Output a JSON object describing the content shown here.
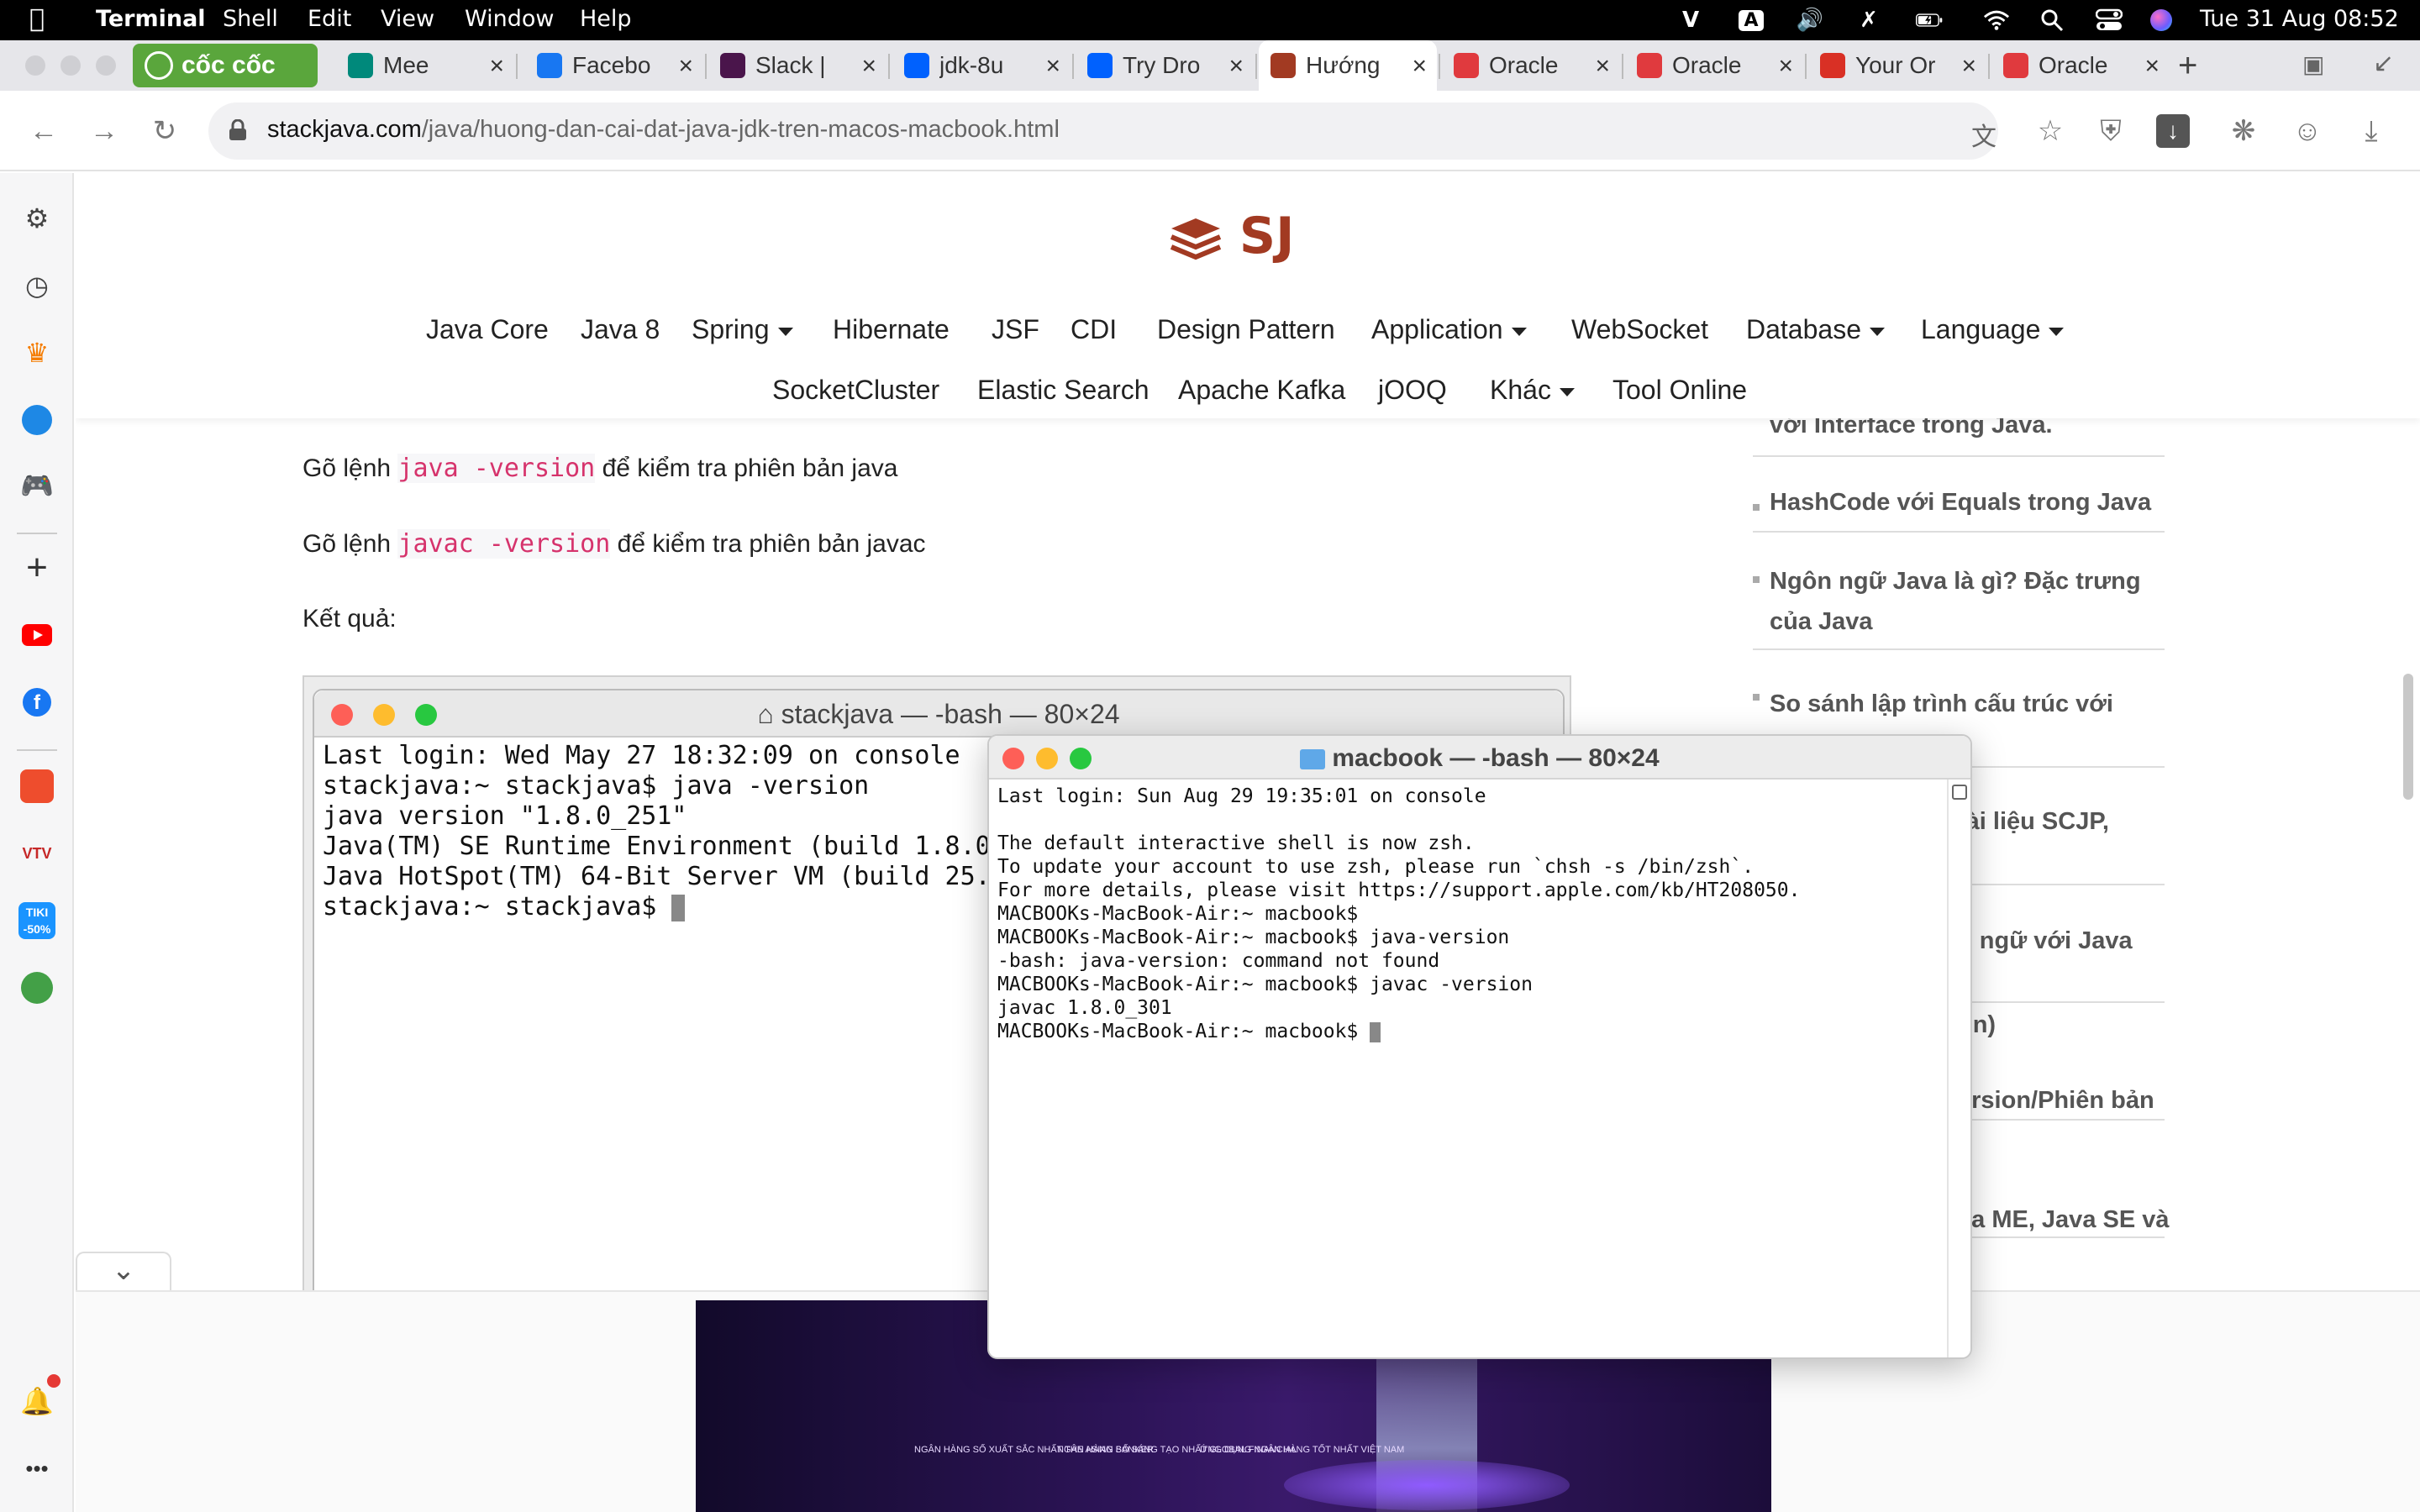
{
  "menubar": {
    "app": "Terminal",
    "items": [
      "Shell",
      "Edit",
      "View",
      "Window",
      "Help"
    ],
    "clock": "Tue 31 Aug  08:52",
    "input_source": "A"
  },
  "browser": {
    "brand_tab": "cốc cốc",
    "tabs": [
      {
        "label": "Mee",
        "icon": "google-meet-icon",
        "color": "#00897b"
      },
      {
        "label": "Facebo",
        "icon": "facebook-icon",
        "color": "#1877f2"
      },
      {
        "label": "Slack |",
        "icon": "slack-icon",
        "color": "#4a154b"
      },
      {
        "label": "jdk-8u",
        "icon": "dropbox-icon",
        "color": "#0061fe"
      },
      {
        "label": "Try Dro",
        "icon": "dropbox-icon",
        "color": "#0061fe"
      },
      {
        "label": "Hướng",
        "icon": "stackjava-icon",
        "color": "#a23a22"
      },
      {
        "label": "Oracle",
        "icon": "oracle-icon",
        "color": "#e03a3e"
      },
      {
        "label": "Oracle",
        "icon": "oracle-icon",
        "color": "#e03a3e"
      },
      {
        "label": "Your Or",
        "icon": "gmail-icon",
        "color": "#d93025"
      },
      {
        "label": "Oracle",
        "icon": "oracle-icon",
        "color": "#e03a3e"
      }
    ],
    "url_host": "stackjava.com",
    "url_path": "/java/huong-dan-cai-dat-java-jdk-tren-macos-macbook.html"
  },
  "site": {
    "logo": "SJ",
    "nav_row1": [
      {
        "label": "Java Core",
        "dropdown": false
      },
      {
        "label": "Java 8",
        "dropdown": false
      },
      {
        "label": "Spring",
        "dropdown": true
      },
      {
        "label": "Hibernate",
        "dropdown": false
      },
      {
        "label": "JSF",
        "dropdown": false
      },
      {
        "label": "CDI",
        "dropdown": false
      },
      {
        "label": "Design Pattern",
        "dropdown": false
      },
      {
        "label": "Application",
        "dropdown": true
      },
      {
        "label": "WebSocket",
        "dropdown": false
      },
      {
        "label": "Database",
        "dropdown": true
      },
      {
        "label": "Language",
        "dropdown": true
      }
    ],
    "nav_row2": [
      {
        "label": "SocketCluster",
        "dropdown": false
      },
      {
        "label": "Elastic Search",
        "dropdown": false
      },
      {
        "label": "Apache Kafka",
        "dropdown": false
      },
      {
        "label": "jOOQ",
        "dropdown": false
      },
      {
        "label": "Khác",
        "dropdown": true
      },
      {
        "label": "Tool Online",
        "dropdown": false
      }
    ],
    "article": {
      "line1_prefix": "Gõ lệnh",
      "line1_code": "java -version",
      "line1_suffix": "để kiểm tra phiên bản java",
      "line2_prefix": "Gõ lệnh",
      "line2_code": "javac -version",
      "line2_suffix": "để kiểm tra phiên bản javac",
      "result": "Kết quả:"
    },
    "sidebar_articles": [
      "với Interface trong Java.",
      "HashCode với Equals trong Java",
      "Ngôn ngữ Java là gì? Đặc trưng của Java",
      "So sánh lập trình cấu trúc với",
      "tài liệu SCJP,",
      "n ngữ với Java",
      "on)",
      "ersion/Phiên bản",
      "va ME, Java SE và"
    ]
  },
  "terminal_bg": {
    "title": "stackjava — -bash — 80×24",
    "lines": [
      "Last login: Wed May 27 18:32:09 on console",
      "stackjava:~ stackjava$ java -version",
      "java version \"1.8.0_251\"",
      "Java(TM) SE Runtime Environment (build 1.8.0",
      "Java HotSpot(TM) 64-Bit Server VM (build 25.2",
      "stackjava:~ stackjava$ "
    ]
  },
  "terminal_fg": {
    "title": "macbook — -bash — 80×24",
    "lines": [
      "Last login: Sun Aug 29 19:35:01 on console",
      "",
      "The default interactive shell is now zsh.",
      "To update your account to use zsh, please run `chsh -s /bin/zsh`.",
      "For more details, please visit https://support.apple.com/kb/HT208050.",
      "MACBOOKs-MacBook-Air:~ macbook$",
      "MACBOOKs-MacBook-Air:~ macbook$ java-version",
      "-bash: java-version: command not found",
      "MACBOOKs-MacBook-Air:~ macbook$ javac -version",
      "javac 1.8.0_301",
      "MACBOOKs-MacBook-Air:~ macbook$ "
    ]
  },
  "banner": {
    "text1": "NGÂN HÀNG SỐ XUẤT SẮC NHẤT THE ASIAN BANKER",
    "text2": "NGÂN HÀNG SỐ SÁNG TẠO NHẤT GLOBAL FINANCIAL",
    "text3": "ỨNG DỤNG NGÂN HÀNG TỐT NHẤT VIỆT NAM"
  },
  "colors": {
    "accent": "#a23a22",
    "code": "#d6336c",
    "menubar": "#000000"
  }
}
